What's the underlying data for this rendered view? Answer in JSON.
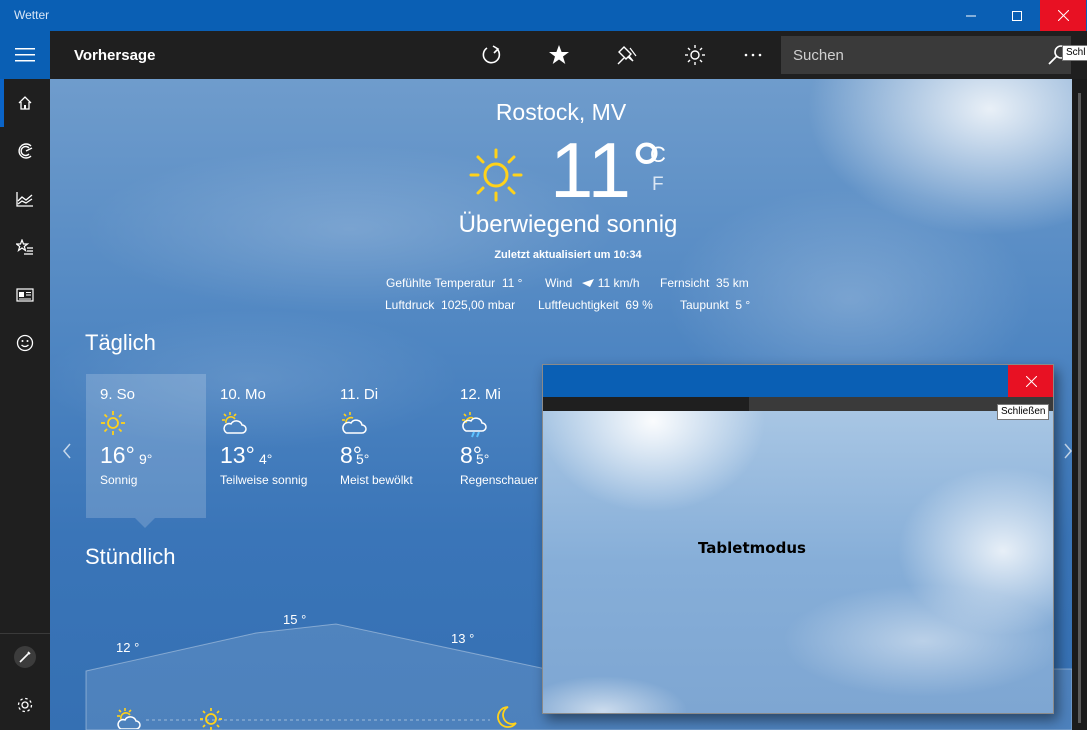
{
  "window": {
    "title": "Wetter",
    "close_tooltip": "Schl"
  },
  "header": {
    "page_title": "Vorhersage",
    "search_placeholder": "Suchen"
  },
  "current": {
    "location": "Rostock, MV",
    "temperature": "11°",
    "unit_c": "C",
    "unit_f": "F",
    "condition": "Überwiegend sonnig",
    "updated": "Zuletzt aktualisiert um 10:34",
    "details": [
      {
        "label": "Gefühlte Temperatur",
        "value": "11 °"
      },
      {
        "label": "Wind",
        "value": "11 km/h"
      },
      {
        "label": "Fernsicht",
        "value": "35 km"
      },
      {
        "label": "Luftdruck",
        "value": "1025,00 mbar"
      },
      {
        "label": "Luftfeuchtigkeit",
        "value": "69 %"
      },
      {
        "label": "Taupunkt",
        "value": "5 °"
      }
    ]
  },
  "daily": {
    "heading": "Täglich",
    "days": [
      {
        "name": "9. So",
        "high": "16°",
        "low": "9°",
        "desc": "Sonnig",
        "icon": "sun-icon"
      },
      {
        "name": "10. Mo",
        "high": "13°",
        "low": "4°",
        "desc": "Teilweise sonnig",
        "icon": "partly-sunny-icon"
      },
      {
        "name": "11. Di",
        "high": "8°",
        "low": "5°",
        "desc": "Meist bewölkt",
        "icon": "mostly-cloudy-icon"
      },
      {
        "name": "12. Mi",
        "high": "8°",
        "low": "5°",
        "desc": "Regenschauer",
        "icon": "rain-showers-icon"
      }
    ]
  },
  "hourly": {
    "heading": "Stündlich",
    "labels": [
      "12 °",
      "15 °",
      "13 °"
    ]
  },
  "popup": {
    "close_tooltip": "Schließen",
    "content_text": "Tabletmodus"
  }
}
